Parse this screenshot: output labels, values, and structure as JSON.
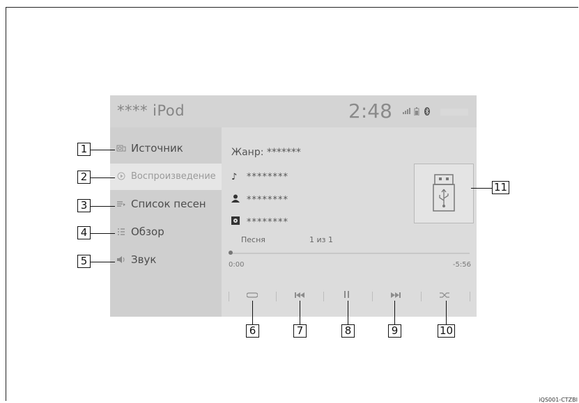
{
  "header": {
    "app_title": "**** iPod",
    "clock": "2:48",
    "signal_icon": "signal-bars-icon",
    "battery_icon": "battery-icon",
    "bluetooth_icon": "bluetooth-icon"
  },
  "sidebar": {
    "items": [
      {
        "label": "Источник",
        "icon": "source-icon"
      },
      {
        "label": "Воспроизведение",
        "icon": "play-icon"
      },
      {
        "label": "Список песен",
        "icon": "playlist-icon"
      },
      {
        "label": "Обзор",
        "icon": "browse-icon"
      },
      {
        "label": "Звук",
        "icon": "speaker-icon"
      }
    ]
  },
  "track": {
    "genre": "Жанр: *******",
    "title": "********",
    "artist": "********",
    "album": "********",
    "song_label": "Песня",
    "song_count": "1 из 1",
    "elapsed": "0:00",
    "remaining": "-5:56",
    "progress_fraction": 0.0
  },
  "controls": {
    "repeat_icon": "repeat-icon",
    "prev_icon": "previous-track-icon",
    "pause_icon": "pause-icon",
    "next_icon": "next-track-icon",
    "shuffle_icon": "shuffle-icon"
  },
  "album_art_icon": "usb-device-icon",
  "callouts": [
    "1",
    "2",
    "3",
    "4",
    "5",
    "6",
    "7",
    "8",
    "9",
    "10",
    "11"
  ],
  "footer_code": "iQS001-CTZBI"
}
